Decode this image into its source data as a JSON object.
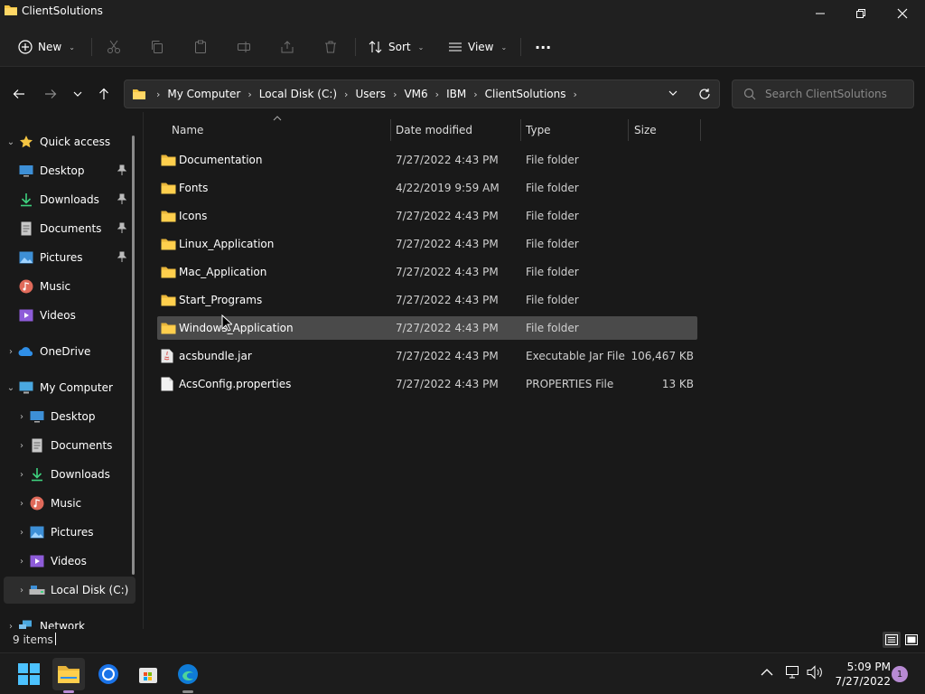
{
  "window": {
    "title": "ClientSolutions"
  },
  "toolbar": {
    "new_label": "New",
    "sort_label": "Sort",
    "view_label": "View",
    "more_label": "···"
  },
  "address": {
    "crumbs": [
      "My Computer",
      "Local Disk (C:)",
      "Users",
      "VM6",
      "IBM",
      "ClientSolutions"
    ]
  },
  "search": {
    "placeholder": "Search ClientSolutions"
  },
  "nav": {
    "quick_access": "Quick access",
    "pinned": [
      {
        "label": "Desktop",
        "icon": "desktop-icon"
      },
      {
        "label": "Downloads",
        "icon": "downloads-icon"
      },
      {
        "label": "Documents",
        "icon": "documents-icon"
      },
      {
        "label": "Pictures",
        "icon": "pictures-icon"
      }
    ],
    "unpinned": [
      {
        "label": "Music",
        "icon": "music-icon"
      },
      {
        "label": "Videos",
        "icon": "videos-icon"
      }
    ],
    "onedrive": "OneDrive",
    "my_computer": "My Computer",
    "computer_items": [
      {
        "label": "Desktop",
        "icon": "desktop-icon"
      },
      {
        "label": "Documents",
        "icon": "documents-icon"
      },
      {
        "label": "Downloads",
        "icon": "downloads-icon"
      },
      {
        "label": "Music",
        "icon": "music-icon"
      },
      {
        "label": "Pictures",
        "icon": "pictures-icon"
      },
      {
        "label": "Videos",
        "icon": "videos-icon"
      },
      {
        "label": "Local Disk (C:)",
        "icon": "drive-icon"
      }
    ],
    "network": "Network"
  },
  "columns": {
    "name": "Name",
    "date": "Date modified",
    "type": "Type",
    "size": "Size"
  },
  "files": [
    {
      "name": "Documentation",
      "date": "7/27/2022 4:43 PM",
      "type": "File folder",
      "size": "",
      "kind": "folder"
    },
    {
      "name": "Fonts",
      "date": "4/22/2019 9:59 AM",
      "type": "File folder",
      "size": "",
      "kind": "folder"
    },
    {
      "name": "Icons",
      "date": "7/27/2022 4:43 PM",
      "type": "File folder",
      "size": "",
      "kind": "folder"
    },
    {
      "name": "Linux_Application",
      "date": "7/27/2022 4:43 PM",
      "type": "File folder",
      "size": "",
      "kind": "folder"
    },
    {
      "name": "Mac_Application",
      "date": "7/27/2022 4:43 PM",
      "type": "File folder",
      "size": "",
      "kind": "folder"
    },
    {
      "name": "Start_Programs",
      "date": "7/27/2022 4:43 PM",
      "type": "File folder",
      "size": "",
      "kind": "folder"
    },
    {
      "name": "Windows_Application",
      "date": "7/27/2022 4:43 PM",
      "type": "File folder",
      "size": "",
      "kind": "folder",
      "selected": true
    },
    {
      "name": "acsbundle.jar",
      "date": "7/27/2022 4:43 PM",
      "type": "Executable Jar File",
      "size": "106,467 KB",
      "kind": "jar"
    },
    {
      "name": "AcsConfig.properties",
      "date": "7/27/2022 4:43 PM",
      "type": "PROPERTIES File",
      "size": "13 KB",
      "kind": "file"
    }
  ],
  "status": {
    "count": "9 items"
  },
  "taskbar": {
    "time": "5:09 PM",
    "date": "7/27/2022",
    "badge": "1"
  },
  "colors": {
    "folder": "#f5c542",
    "accent": "#4cc2ff",
    "background": "#191919"
  }
}
